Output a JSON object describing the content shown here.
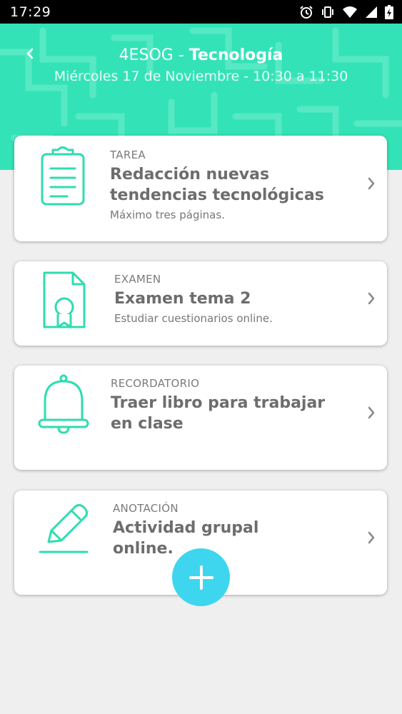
{
  "status_bar": {
    "time": "17:29"
  },
  "header": {
    "group": "4ESOG",
    "separator": " - ",
    "subject": "Tecnología",
    "subtitle": "Miércoles 17 de Noviembre - 10:30 a 11:30"
  },
  "cards": [
    {
      "category": "TAREA",
      "title_line1": "Redacción nuevas",
      "title_line2": "tendencias tecnológicas",
      "description": "Máximo tres páginas.",
      "icon": "clipboard-icon"
    },
    {
      "category": "EXAMEN",
      "title_line1": "Examen tema 2",
      "description": "Estudiar cuestionarios online.",
      "icon": "certificate-icon"
    },
    {
      "category": "RECORDATORIO",
      "title_line1": "Traer libro para trabajar",
      "title_line2": "en clase",
      "icon": "bell-icon"
    },
    {
      "category": "ANOTACIÓN",
      "title_line1": "Actividad grupal",
      "title_line2": "online.",
      "icon": "pencil-icon"
    }
  ],
  "colors": {
    "header": "#33e3b7",
    "icon": "#2fdcb0",
    "fab": "#3ed6ef"
  }
}
